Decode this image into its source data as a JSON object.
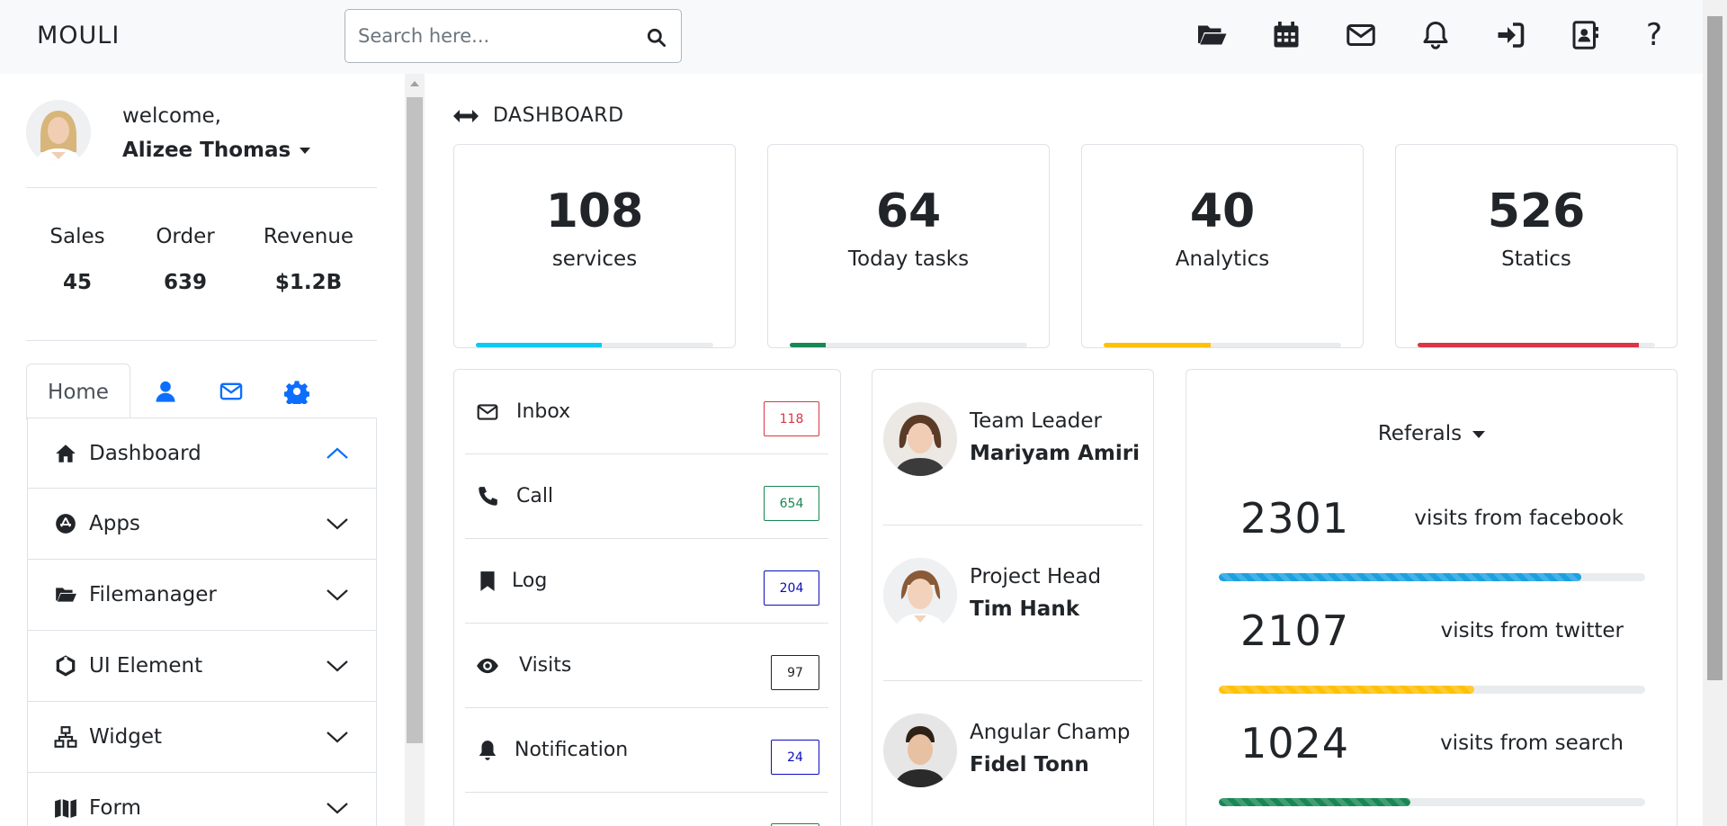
{
  "navbar": {
    "brand": "MOULI",
    "search_placeholder": "Search here...",
    "icons": [
      "folder-open-icon",
      "calendar-icon",
      "envelope-icon",
      "bell-icon",
      "sign-in-icon",
      "contact-card-icon",
      "question-icon"
    ],
    "help_glyph": "?"
  },
  "sidebar": {
    "welcome": "welcome,",
    "username": "Alizee Thomas",
    "stats": [
      {
        "label": "Sales",
        "value": "45"
      },
      {
        "label": "Order",
        "value": "639"
      },
      {
        "label": "Revenue",
        "value": "$1.2B"
      }
    ],
    "tabs": {
      "home": "Home",
      "icons": [
        "user-icon",
        "envelope-icon",
        "gear-icon"
      ]
    },
    "menu": [
      {
        "label": "Dashboard",
        "icon": "home-icon",
        "expanded": true
      },
      {
        "label": "Apps",
        "icon": "app-store-icon",
        "expanded": false
      },
      {
        "label": "Filemanager",
        "icon": "folder-open-icon",
        "expanded": false
      },
      {
        "label": "UI Element",
        "icon": "rotate-icon",
        "expanded": false
      },
      {
        "label": "Widget",
        "icon": "sitemap-icon",
        "expanded": false
      },
      {
        "label": "Form",
        "icon": "map-icon",
        "expanded": false
      }
    ]
  },
  "main": {
    "breadcrumb": "DASHBOARD",
    "cards": [
      {
        "number": "108",
        "label": "services",
        "progress": 0.53,
        "color": "#0dcaf0"
      },
      {
        "number": "64",
        "label": "Today tasks",
        "progress": 0.15,
        "color": "#198754"
      },
      {
        "number": "40",
        "label": "Analytics",
        "progress": 0.45,
        "color": "#ffc107"
      },
      {
        "number": "526",
        "label": "Statics",
        "progress": 0.93,
        "color": "#dc3545"
      }
    ],
    "messages": [
      {
        "label": "Inbox",
        "count": "118",
        "icon": "envelope-icon",
        "color": "#dc3545"
      },
      {
        "label": "Call",
        "count": "654",
        "icon": "phone-icon",
        "color": "#198754"
      },
      {
        "label": "Log",
        "count": "204",
        "icon": "bookmark-icon",
        "color": "#0d0dbd"
      },
      {
        "label": "Visits",
        "count": "97",
        "icon": "eye-icon",
        "color": "#212529"
      },
      {
        "label": "Notification",
        "count": "24",
        "icon": "bell-icon",
        "color": "#0d0dbd"
      }
    ],
    "team": [
      {
        "role": "Team Leader",
        "name": "Mariyam Amiri"
      },
      {
        "role": "Project Head",
        "name": "Tim Hank"
      },
      {
        "role": "Angular Champ",
        "name": "Fidel Tonn"
      }
    ],
    "referrals": {
      "title": "Referals",
      "rows": [
        {
          "value": "2301",
          "label": "visits from facebook",
          "progress": 0.85,
          "color": "#1ba1e2"
        },
        {
          "value": "2107",
          "label": "visits from twitter",
          "progress": 0.6,
          "color": "#ffc107"
        },
        {
          "value": "1024",
          "label": "visits from search",
          "progress": 0.45,
          "color": "#198754"
        }
      ]
    }
  }
}
